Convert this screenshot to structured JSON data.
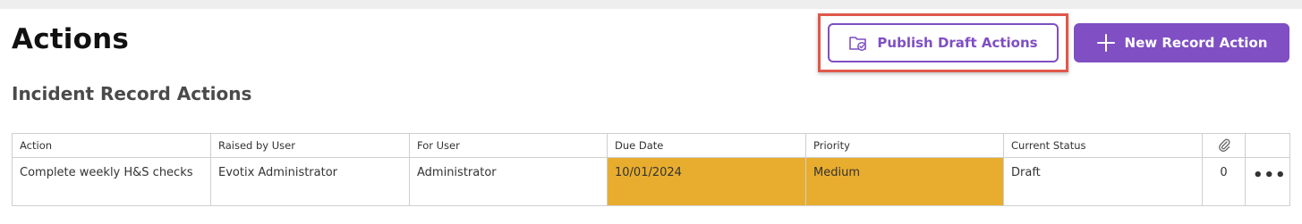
{
  "header": {
    "title": "Actions",
    "publish_label": "Publish Draft Actions",
    "new_label": "New Record Action"
  },
  "section": {
    "title": "Incident Record Actions"
  },
  "icons": {
    "publish": "folder-check-icon",
    "new": "plus-icon",
    "attachments": "paperclip-icon",
    "row_menu": "more-horizontal-icon"
  },
  "colors": {
    "accent": "#7f4fc3",
    "highlight_outline": "#e0584a",
    "due_priority_fill": "#e8ad2e"
  },
  "table": {
    "columns": [
      "Action",
      "Raised by User",
      "For User",
      "Due Date",
      "Priority",
      "Current Status"
    ],
    "rows": [
      {
        "action": "Complete weekly H&S checks",
        "raised_by": "Evotix Administrator",
        "for_user": "Administrator",
        "due_date": "10/01/2024",
        "priority": "Medium",
        "status": "Draft",
        "attachments": "0",
        "menu": "•••"
      }
    ]
  }
}
